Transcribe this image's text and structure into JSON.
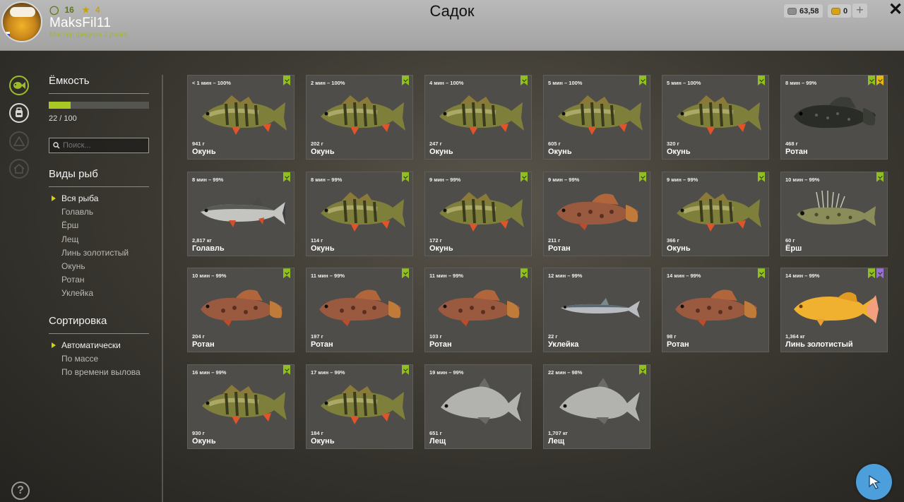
{
  "header": {
    "title": "Садок",
    "username": "MaksFil11",
    "rank": "Мастер фидера 2 ранга",
    "level": "16",
    "stars": "4",
    "silver": "63,58",
    "gold": "0",
    "add_label": "+",
    "close_label": "✕"
  },
  "capacity": {
    "title": "Ёмкость",
    "current": 22,
    "max": 100,
    "label": "22 / 100"
  },
  "search": {
    "placeholder": "Поиск..."
  },
  "species": {
    "title": "Виды рыб",
    "items": [
      "Вся рыба",
      "Голавль",
      "Ёрш",
      "Лещ",
      "Линь золотистый",
      "Окунь",
      "Ротан",
      "Уклейка"
    ],
    "selected": 0
  },
  "sorting": {
    "title": "Сортировка",
    "items": [
      "Автоматически",
      "По массе",
      "По времени вылова"
    ],
    "selected": 0
  },
  "help_label": "?",
  "colors": {
    "accent": "#9dbb2a",
    "capacity_fill": "#a7c825",
    "badge_green": "#8fbf20",
    "badge_gold": "#e6b80f",
    "badge_purple": "#9a6fd8",
    "fab": "#4d9fdc"
  },
  "fish": [
    {
      "time": "< 1 мин – 100%",
      "weight": "941 г",
      "name": "Окунь",
      "icon": "perch",
      "badges": [
        "green"
      ]
    },
    {
      "time": "2 мин – 100%",
      "weight": "202 г",
      "name": "Окунь",
      "icon": "perch",
      "badges": [
        "green"
      ]
    },
    {
      "time": "4 мин – 100%",
      "weight": "247 г",
      "name": "Окунь",
      "icon": "perch",
      "badges": [
        "green"
      ]
    },
    {
      "time": "5 мин – 100%",
      "weight": "605 г",
      "name": "Окунь",
      "icon": "perch",
      "badges": [
        "green"
      ]
    },
    {
      "time": "5 мин – 100%",
      "weight": "320 г",
      "name": "Окунь",
      "icon": "perch",
      "badges": [
        "green"
      ]
    },
    {
      "time": "8 мин – 99%",
      "weight": "468 г",
      "name": "Ротан",
      "icon": "dark-rotan",
      "badges": [
        "green",
        "gold"
      ]
    },
    {
      "time": "8 мин – 99%",
      "weight": "2,817 кг",
      "name": "Голавль",
      "icon": "chub",
      "badges": [
        "green"
      ]
    },
    {
      "time": "8 мин – 99%",
      "weight": "114 г",
      "name": "Окунь",
      "icon": "perch",
      "badges": [
        "green"
      ]
    },
    {
      "time": "9 мин – 99%",
      "weight": "172 г",
      "name": "Окунь",
      "icon": "perch",
      "badges": [
        "green"
      ]
    },
    {
      "time": "9 мин – 99%",
      "weight": "211 г",
      "name": "Ротан",
      "icon": "rotan",
      "badges": [
        "green"
      ]
    },
    {
      "time": "9 мин – 99%",
      "weight": "366 г",
      "name": "Окунь",
      "icon": "perch",
      "badges": [
        "green"
      ]
    },
    {
      "time": "10 мин – 99%",
      "weight": "60 г",
      "name": "Ёрш",
      "icon": "ruffe",
      "badges": [
        "green"
      ]
    },
    {
      "time": "10 мин – 99%",
      "weight": "204 г",
      "name": "Ротан",
      "icon": "rotan",
      "badges": [
        "green"
      ]
    },
    {
      "time": "11 мин – 99%",
      "weight": "197 г",
      "name": "Ротан",
      "icon": "rotan",
      "badges": [
        "green"
      ]
    },
    {
      "time": "11 мин – 99%",
      "weight": "103 г",
      "name": "Ротан",
      "icon": "rotan",
      "badges": [
        "green"
      ]
    },
    {
      "time": "12 мин – 99%",
      "weight": "22 г",
      "name": "Уклейка",
      "icon": "bleak",
      "badges": []
    },
    {
      "time": "14 мин – 99%",
      "weight": "98 г",
      "name": "Ротан",
      "icon": "rotan",
      "badges": [
        "green"
      ]
    },
    {
      "time": "14 мин – 99%",
      "weight": "1,364 кг",
      "name": "Линь золотистый",
      "icon": "tench",
      "badges": [
        "green",
        "purple"
      ]
    },
    {
      "time": "16 мин – 99%",
      "weight": "930 г",
      "name": "Окунь",
      "icon": "perch",
      "badges": [
        "green"
      ]
    },
    {
      "time": "17 мин – 99%",
      "weight": "184 г",
      "name": "Окунь",
      "icon": "perch",
      "badges": [
        "green"
      ]
    },
    {
      "time": "19 мин – 99%",
      "weight": "651 г",
      "name": "Лещ",
      "icon": "bream",
      "badges": []
    },
    {
      "time": "22 мин – 98%",
      "weight": "1,707 кг",
      "name": "Лещ",
      "icon": "bream",
      "badges": [
        "green"
      ]
    }
  ]
}
